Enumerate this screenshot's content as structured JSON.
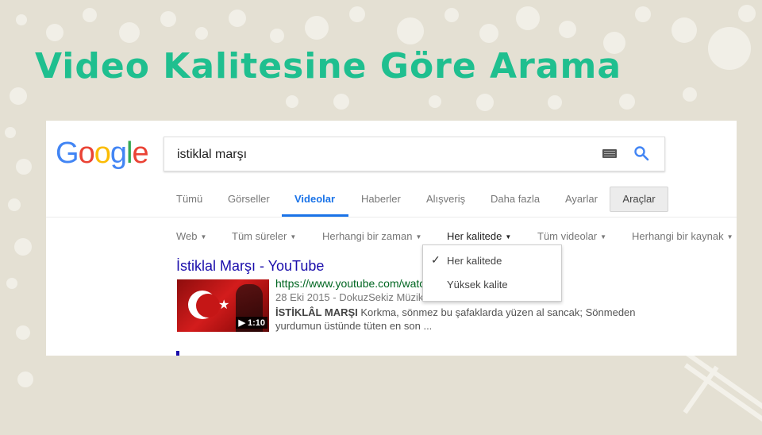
{
  "slide": {
    "title": "Video Kalitesine Göre Arama"
  },
  "google": {
    "logo_letters": [
      {
        "ch": "G",
        "color": "#4285F4"
      },
      {
        "ch": "o",
        "color": "#EA4335"
      },
      {
        "ch": "o",
        "color": "#FBBC05"
      },
      {
        "ch": "g",
        "color": "#4285F4"
      },
      {
        "ch": "l",
        "color": "#34A853"
      },
      {
        "ch": "e",
        "color": "#EA4335"
      }
    ],
    "search": {
      "value": "istiklal marşı",
      "keyboard_icon": "keyboard-icon",
      "search_icon": "search-icon"
    },
    "tabs": [
      "Tümü",
      "Görseller",
      "Videolar",
      "Haberler",
      "Alışveriş",
      "Daha fazla",
      "Ayarlar"
    ],
    "active_tab": "Videolar",
    "tools_label": "Araçlar",
    "filters": [
      "Web",
      "Tüm süreler",
      "Herhangi bir zaman",
      "Her kalitede",
      "Tüm videolar",
      "Herhangi bir kaynak"
    ],
    "selected_filter": "Her kalitede",
    "dropdown": {
      "items": [
        "Her kalitede",
        "Yüksek kalite"
      ],
      "checked": "Her kalitede"
    },
    "result": {
      "title": "İstiklal Marşı - YouTube",
      "url": "https://www.youtube.com/watc",
      "meta": "28 Eki 2015 - DokuzSekiz Müzik",
      "snippet_bold": "İSTİKLÂL MARŞI",
      "snippet_rest": " Korkma, sönmez bu şafaklarda yüzen al sancak; Sönmeden yurdumun üstünde tüten en son ...",
      "duration": "▶ 1:10"
    }
  }
}
